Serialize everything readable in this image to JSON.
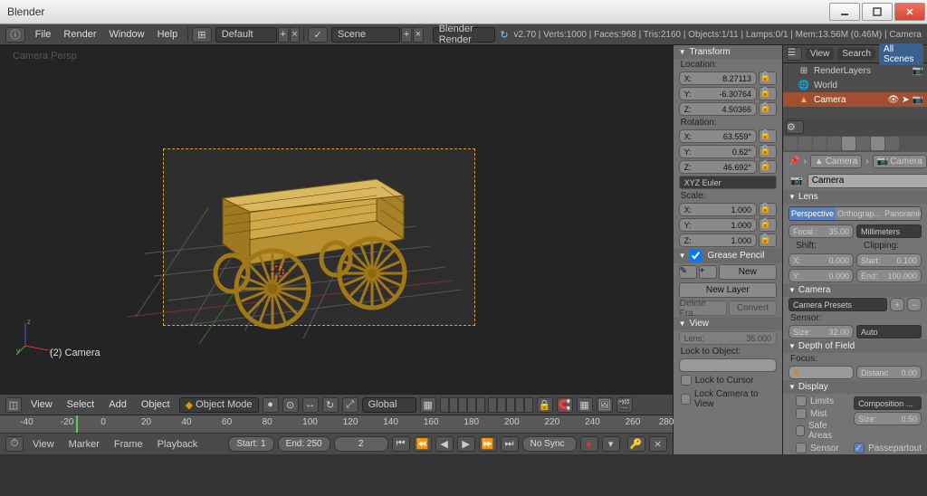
{
  "window": {
    "title": "Blender"
  },
  "topbar": {
    "menus": [
      "File",
      "Render",
      "Window",
      "Help"
    ],
    "layout": "Default",
    "scene": "Scene",
    "engine": "Blender Render",
    "stats": "v2.70 | Verts:1000 | Faces:968 | Tris:2160 | Objects:1/11 | Lamps:0/1 | Mem:13.56M (0.46M) | Camera"
  },
  "viewport": {
    "view_label": "Camera Persp",
    "object_label": "(2) Camera"
  },
  "viewtool": {
    "menus": [
      "View",
      "Select",
      "Add",
      "Object"
    ],
    "mode": "Object Mode",
    "orient": "Global"
  },
  "timeline": {
    "ticks": [
      "-40",
      "-20",
      "0",
      "20",
      "40",
      "60",
      "80",
      "100",
      "120",
      "140",
      "160",
      "180",
      "200",
      "220",
      "240",
      "260",
      "280"
    ],
    "menus": [
      "View",
      "Marker",
      "Frame",
      "Playback"
    ],
    "start_label": "Start:",
    "start_val": "1",
    "end_label": "End:",
    "end_val": "250",
    "current": "2",
    "sync": "No Sync"
  },
  "npanel": {
    "transform": "Transform",
    "location": "Location:",
    "loc": {
      "x": "8.27113",
      "y": "-6.30764",
      "z": "4.50366"
    },
    "rotation": "Rotation:",
    "rot": {
      "x": "63.559°",
      "y": "0.62°",
      "z": "46.692°"
    },
    "rotmode": "XYZ Euler",
    "scale": "Scale:",
    "sc": {
      "x": "1.000",
      "y": "1.000",
      "z": "1.000"
    },
    "gp": "Grease Pencil",
    "gp_new": "New",
    "gp_layer": "New Layer",
    "gp_del": "Delete Fra...",
    "gp_conv": "Convert",
    "view": "View",
    "lens_label": "Lens:",
    "lens": "35.000",
    "lock_obj": "Lock to Object:",
    "lock_cur": "Lock to Cursor",
    "lock_cam": "Lock Camera to View"
  },
  "outliner": {
    "tabs": [
      "View",
      "Search",
      "All Scenes"
    ],
    "items": [
      "RenderLayers",
      "World",
      "Camera"
    ]
  },
  "props": {
    "bc1": "Camera",
    "bc2": "Camera",
    "name": "Camera",
    "pin": "F",
    "lens_hd": "Lens",
    "lens_type": [
      "Perspective",
      "Orthograp...",
      "Panoramic"
    ],
    "focal_label": "Focal :",
    "focal": "35.00",
    "units": "Millimeters",
    "shift_hd": "Shift:",
    "clip_hd": "Clipping:",
    "shx": "0.000",
    "shy": "0.000",
    "clst": "0.100",
    "clen": "100.000",
    "cam_hd": "Camera",
    "presets": "Camera Presets",
    "sensor_hd": "Sensor:",
    "size_lbl": "Size:",
    "size": "32.00",
    "fit": "Auto",
    "dof_hd": "Depth of Field",
    "focus": "Focus:",
    "dist_lbl": "Distanc",
    "dist": "0.00",
    "disp_hd": "Display",
    "limits": "Limits",
    "mist": "Mist",
    "safe": "Safe Areas",
    "sensor_chk": "Sensor",
    "comp": "Composition ...",
    "dsize_lbl": "Size:",
    "dsize": "0.50",
    "pass": "Passepartout"
  }
}
